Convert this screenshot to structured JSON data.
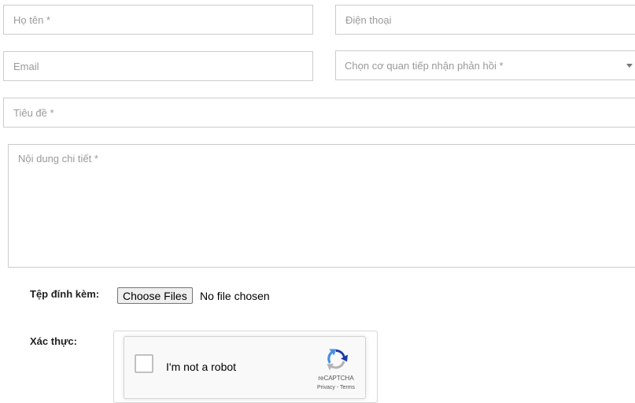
{
  "form": {
    "fullname_placeholder": "Họ tên *",
    "phone_placeholder": "Điện thoại",
    "email_placeholder": "Email",
    "agency_placeholder": "Chọn cơ quan tiếp nhận phản hồi *",
    "subject_placeholder": "Tiêu đề *",
    "details_placeholder": "Nội dung chi tiết *"
  },
  "attachment": {
    "label": "Tệp đính kèm:",
    "button": "Choose Files",
    "status": "No file chosen"
  },
  "verification": {
    "label": "Xác thực:",
    "checkbox_label": "I'm not a robot",
    "brand": "reCAPTCHA",
    "privacy": "Privacy",
    "separator": " - ",
    "terms": "Terms"
  },
  "colors": {
    "border": "#cccccc",
    "placeholder": "#9a9a9a",
    "recaptcha_bg": "#f9f9f9",
    "recaptcha_blue": "#1c3aa9",
    "recaptcha_lightblue": "#4a90e2",
    "recaptcha_gray": "#b3b3b3"
  }
}
